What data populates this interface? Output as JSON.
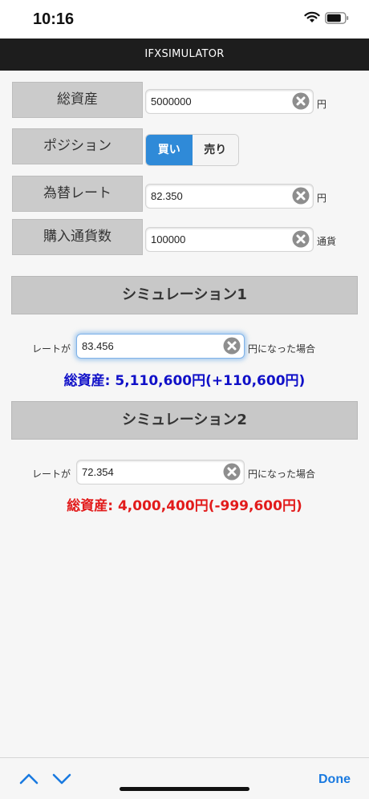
{
  "status_bar": {
    "time": "10:16"
  },
  "header": {
    "title": "IFXSIMULATOR"
  },
  "form": {
    "total_assets": {
      "label": "総資産",
      "value": "5000000",
      "unit": "円"
    },
    "position": {
      "label": "ポジション",
      "buy": "買い",
      "sell": "売り",
      "selected": "buy"
    },
    "rate": {
      "label": "為替レート",
      "value": "82.350",
      "unit": "円"
    },
    "amount": {
      "label": "購入通貨数",
      "value": "100000",
      "unit": "通貨"
    }
  },
  "simulation1": {
    "title": "シミュレーション1",
    "prefix": "レートが",
    "value": "83.456",
    "suffix": "円になった場合",
    "result": "総資産: 5,110,600円(+110,600円)",
    "result_color": "#1010c8"
  },
  "simulation2": {
    "title": "シミュレーション2",
    "prefix": "レートが",
    "value": "72.354",
    "suffix": "円になった場合",
    "result": "総資産: 4,000,400円(-999,600円)",
    "result_color": "#e21b1b"
  },
  "toolbar": {
    "done_label": "Done"
  },
  "colors": {
    "accent": "#2f8ad8",
    "header_bg": "#1d1d1d",
    "done": "#1a7ae0"
  }
}
